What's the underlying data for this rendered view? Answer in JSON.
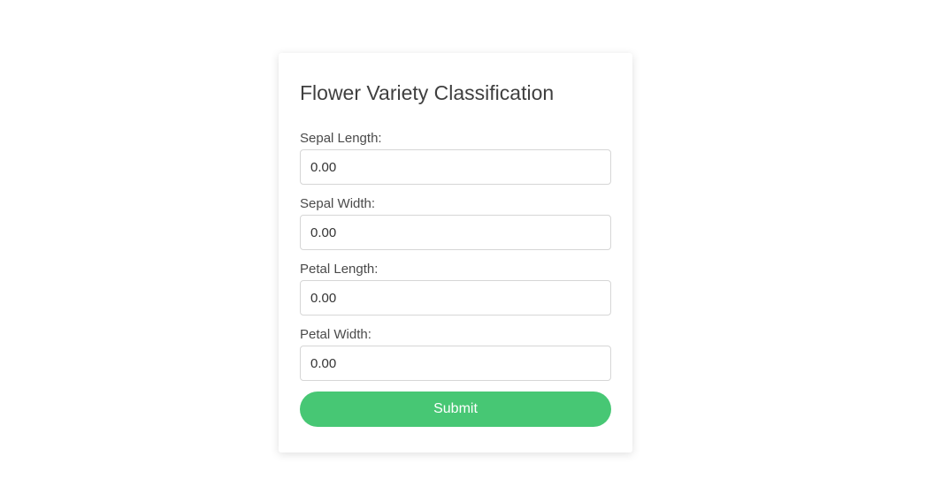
{
  "form": {
    "title": "Flower Variety Classification",
    "fields": [
      {
        "label": "Sepal Length:",
        "value": "0.00"
      },
      {
        "label": "Sepal Width:",
        "value": "0.00"
      },
      {
        "label": "Petal Length:",
        "value": "0.00"
      },
      {
        "label": "Petal Width:",
        "value": "0.00"
      }
    ],
    "submit_label": "Submit"
  },
  "colors": {
    "submit_background": "#47c774",
    "title_text": "#3f3f3f",
    "input_border": "#d6d6d6"
  }
}
